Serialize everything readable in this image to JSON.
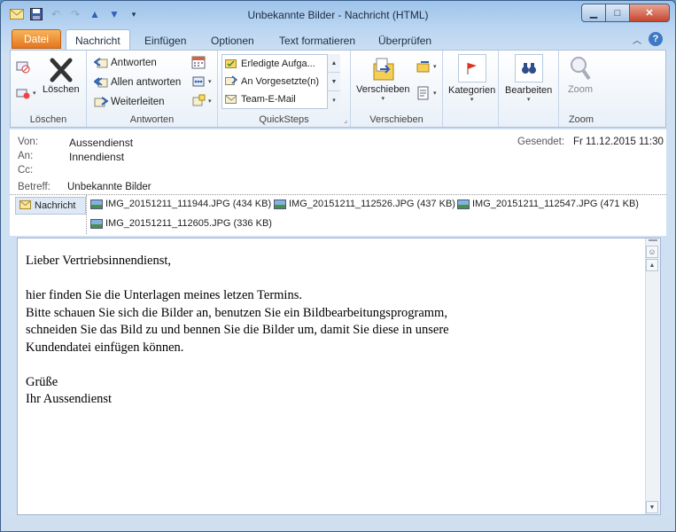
{
  "window": {
    "title": "Unbekannte Bilder  -  Nachricht (HTML)"
  },
  "qat": {
    "icons": [
      "mail-icon",
      "save-icon",
      "undo-icon",
      "redo-icon",
      "up-icon",
      "down-icon",
      "customize-icon"
    ]
  },
  "ribbon_tabs": {
    "file": "Datei",
    "tabs": [
      "Nachricht",
      "Einfügen",
      "Optionen",
      "Text formatieren",
      "Überprüfen"
    ],
    "active": "Nachricht"
  },
  "groups": {
    "delete": {
      "label": "Löschen",
      "delete_button": "Löschen"
    },
    "respond": {
      "label": "Antworten",
      "reply": "Antworten",
      "reply_all": "Allen antworten",
      "forward": "Weiterleiten"
    },
    "quicksteps": {
      "label": "QuickSteps",
      "items": [
        "Erledigte Aufga...",
        "An Vorgesetzte(n)",
        "Team-E-Mail"
      ]
    },
    "move": {
      "label": "Verschieben",
      "move_button": "Verschieben"
    },
    "tags": {
      "categorize": "Kategorien"
    },
    "editing": {
      "edit": "Bearbeiten"
    },
    "zoom": {
      "label": "Zoom",
      "zoom_button": "Zoom"
    }
  },
  "header": {
    "from_label": "Von:",
    "from": "Aussendienst",
    "to_label": "An:",
    "to": "Innendienst",
    "cc_label": "Cc:",
    "sent_label": "Gesendet:",
    "sent": "Fr 11.12.2015 11:30",
    "subject_label": "Betreff:",
    "subject": "Unbekannte Bilder",
    "message_tab": "Nachricht",
    "attachments": [
      "IMG_20151211_111944.JPG (434 KB)",
      "IMG_20151211_112526.JPG (437 KB)",
      "IMG_20151211_112547.JPG (471 KB)",
      "IMG_20151211_112605.JPG (336 KB)"
    ]
  },
  "body": {
    "greeting": "Lieber Vertriebsinnendienst,",
    "line1": "hier finden Sie die Unterlagen meines letzen Termins.",
    "line2": "Bitte schauen Sie sich die Bilder an, benutzen Sie ein Bildbearbeitungsprogramm,",
    "line3": "schneiden Sie das Bild zu und bennen Sie die Bilder um, damit Sie diese in unsere",
    "line4": "Kundendatei einfügen können.",
    "closing": "Grüße",
    "signature": "Ihr Aussendienst"
  }
}
